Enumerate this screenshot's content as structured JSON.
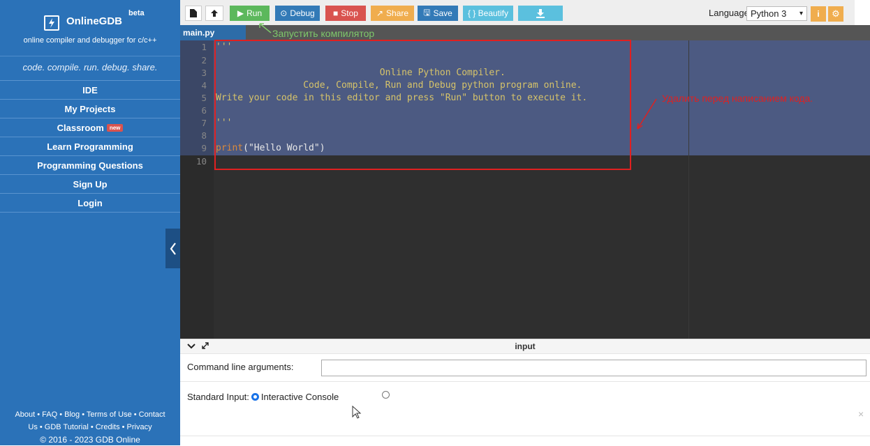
{
  "sidebar": {
    "brand": {
      "title": "OnlineGDB",
      "beta": "beta",
      "subtitle": "online compiler and debugger for c/c++"
    },
    "tagline": "code. compile. run. debug. share.",
    "nav": [
      {
        "label": "IDE"
      },
      {
        "label": "My Projects"
      },
      {
        "label": "Classroom",
        "badge": "new"
      },
      {
        "label": "Learn Programming"
      },
      {
        "label": "Programming Questions"
      },
      {
        "label": "Sign Up"
      },
      {
        "label": "Login"
      }
    ],
    "footer_line1": "About • FAQ • Blog • Terms of Use • Contact",
    "footer_line2": "Us • GDB Tutorial • Credits • Privacy",
    "footer_line3": "© 2016 - 2023 GDB Online"
  },
  "toolbar": {
    "run": "Run",
    "debug": "Debug",
    "stop": "Stop",
    "share": "Share",
    "save": "Save",
    "beautify": "{ } Beautify",
    "language_label": "Language",
    "language_value": "Python 3",
    "colors": {
      "run": "#5cb85c",
      "debug": "#337ab7",
      "stop": "#d9534f",
      "share": "#f0ad4e",
      "save": "#337ab7",
      "beautify": "#5bc0de",
      "download": "#5bc0de"
    }
  },
  "tab": {
    "filename": "main.py"
  },
  "editor": {
    "lines": [
      {
        "n": "1",
        "text": "'''"
      },
      {
        "n": "2",
        "text": ""
      },
      {
        "n": "3",
        "text": "                              Online Python Compiler."
      },
      {
        "n": "4",
        "text": "                Code, Compile, Run and Debug python program online."
      },
      {
        "n": "5",
        "text": "Write your code in this editor and press \"Run\" button to execute it."
      },
      {
        "n": "6",
        "text": ""
      },
      {
        "n": "7",
        "text": "'''"
      },
      {
        "n": "8",
        "text": ""
      },
      {
        "n": "9",
        "kw": "print",
        "rest": "(\"Hello World\")"
      },
      {
        "n": "10",
        "text": ""
      }
    ]
  },
  "annotations": {
    "run_hint": "Запустить компилятор",
    "delete_hint": "Удалить перед написанием кода."
  },
  "io": {
    "header": "input",
    "cmd_label": "Command line arguments:",
    "cmd_value": "",
    "stdin_label": "Standard Input:",
    "interactive_console": "Interactive Console",
    "close": "×"
  }
}
